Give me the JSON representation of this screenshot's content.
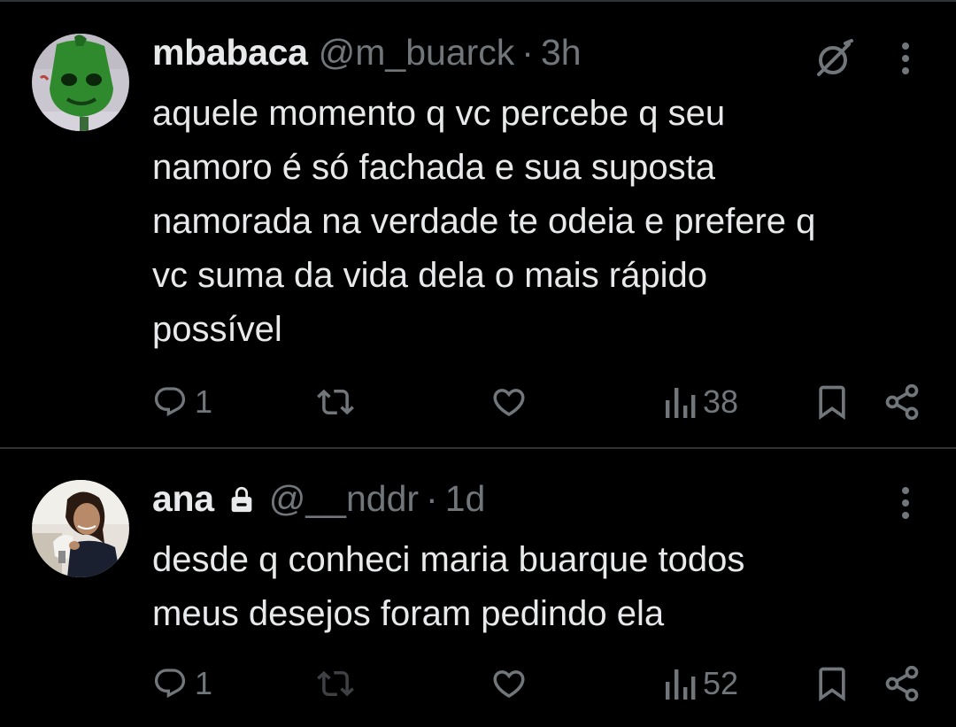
{
  "colors": {
    "background": "#000000",
    "primary_text": "#e7e9ea",
    "secondary_text": "#71767b",
    "divider": "#2f3336"
  },
  "tweets": [
    {
      "name": "mbabaca",
      "handle": "@m_buarck",
      "separator": "·",
      "time": "3h",
      "text": "aquele momento q vc percebe q seu\nnamoro é só fachada e sua suposta\nnamorada na verdade te odeia e prefere q\nvc suma da vida dela o mais rápido\npossível",
      "reply_count": "1",
      "views_count": "38",
      "icons": [
        "avatar",
        "grok-icon",
        "more-icon",
        "reply-icon",
        "retweet-icon",
        "like-icon",
        "views-icon",
        "bookmark-icon",
        "share-icon"
      ]
    },
    {
      "name": "ana",
      "handle": "@__nddr",
      "separator": "·",
      "time": "1d",
      "text": "desde q conheci maria buarque todos\nmeus desejos foram pedindo ela",
      "reply_count": "1",
      "views_count": "52",
      "icons": [
        "avatar",
        "lock-icon",
        "more-icon",
        "reply-icon",
        "retweet-icon",
        "like-icon",
        "views-icon",
        "bookmark-icon",
        "share-icon"
      ]
    }
  ]
}
